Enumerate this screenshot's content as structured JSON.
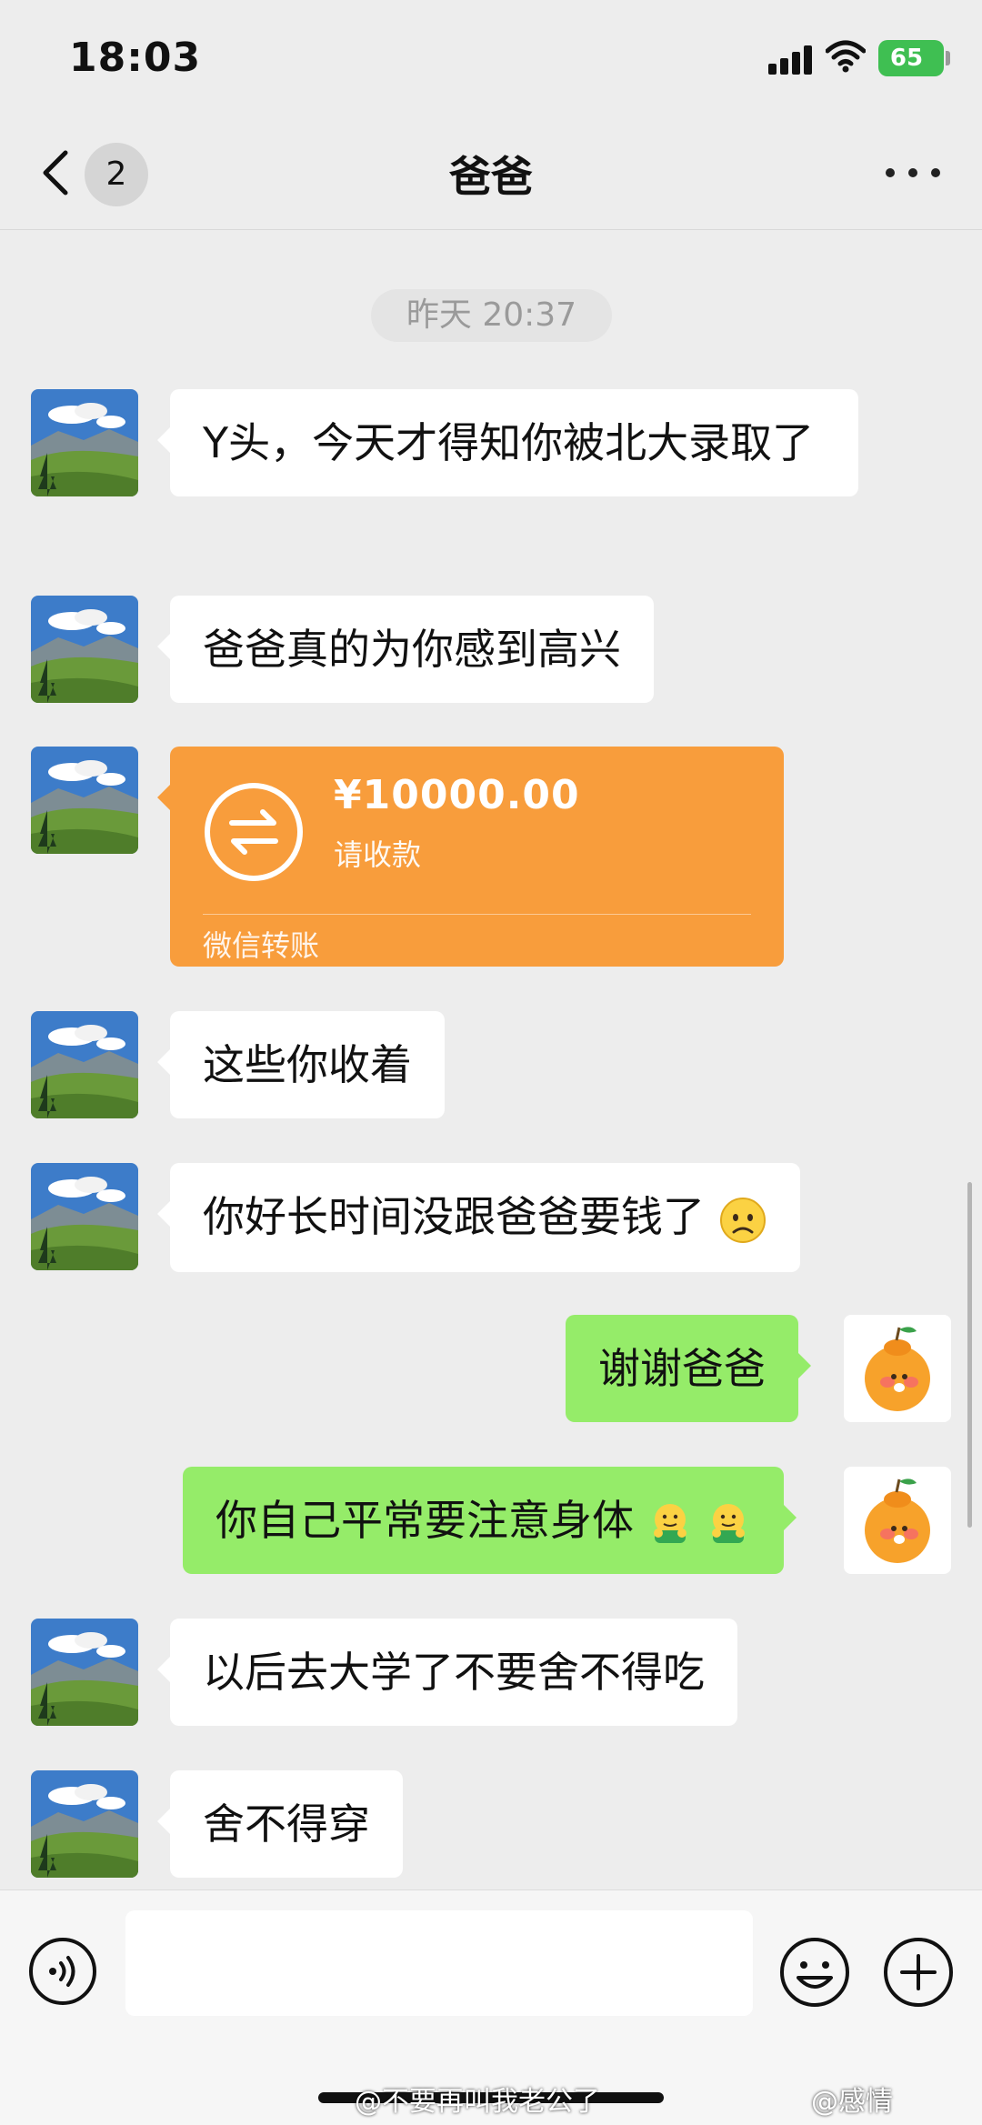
{
  "status_bar": {
    "time": "18:03",
    "battery": "65"
  },
  "nav": {
    "back_count": "2",
    "title": "爸爸"
  },
  "timestamp": "昨天 20:37",
  "messages": [
    {
      "text": "Y头，今天才得知你被北大录取了"
    },
    {
      "text": "爸爸真的为你感到高兴"
    },
    {
      "text": "这些你收着"
    },
    {
      "text": "你好长时间没跟爸爸要钱了"
    },
    {
      "text": "谢谢爸爸"
    },
    {
      "text": "你自己平常要注意身体"
    },
    {
      "text": "以后去大学了不要舍不得吃"
    },
    {
      "text": "舍不得穿"
    }
  ],
  "transfer": {
    "amount": "¥10000.00",
    "status": "请收款",
    "footer": "微信转账"
  },
  "watermark": {
    "left": "@不要再叫我老公了",
    "right": "@感情"
  },
  "colors": {
    "incoming_bubble": "#ffffff",
    "outgoing_bubble": "#95ec69",
    "transfer": "#f89d3c",
    "background": "#ededed"
  },
  "icons": [
    "back-icon",
    "more-icon",
    "transfer-arrows-icon",
    "frown-emoji",
    "hugging-emoji",
    "voice-icon",
    "emoji-icon",
    "plus-icon"
  ]
}
